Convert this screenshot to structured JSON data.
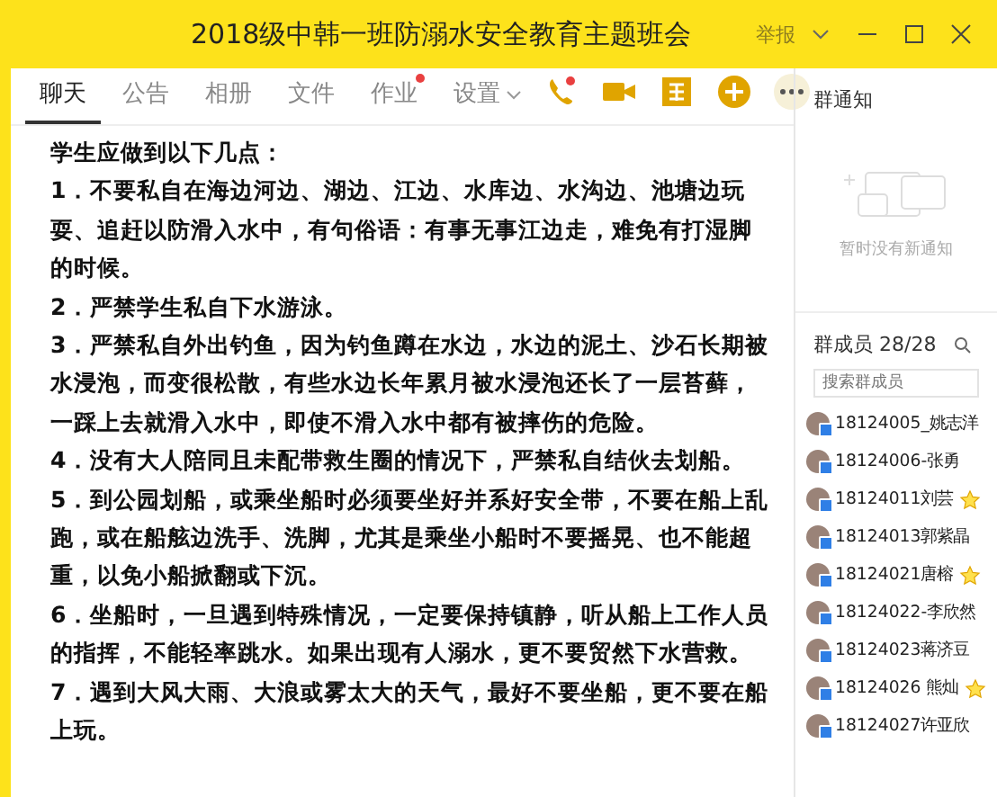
{
  "window": {
    "title": "2018级中韩一班防溺水安全教育主题班会",
    "report": "举报"
  },
  "tabs": [
    {
      "label": "聊天",
      "selected": true,
      "dot": false
    },
    {
      "label": "公告",
      "selected": false,
      "dot": false
    },
    {
      "label": "相册",
      "selected": false,
      "dot": false
    },
    {
      "label": "文件",
      "selected": false,
      "dot": false
    },
    {
      "label": "作业",
      "selected": false,
      "dot": true
    },
    {
      "label": "设置",
      "selected": false,
      "dot": false,
      "menu": true
    }
  ],
  "message": {
    "paragraphs": [
      "学生应做到以下几点：",
      "1．不要私自在海边河边、湖边、江边、水库边、水沟边、池塘边玩耍、追赶以防滑入水中，有句俗语：有事无事江边走，难免有打湿脚的时候。",
      "2．严禁学生私自下水游泳。",
      "3．严禁私自外出钓鱼，因为钓鱼蹲在水边，水边的泥土、沙石长期被水浸泡，而变很松散，有些水边长年累月被水浸泡还长了一层苔藓，一踩上去就滑入水中，即使不滑入水中都有被摔伤的危险。",
      "4．没有大人陪同且未配带救生圈的情况下，严禁私自结伙去划船。",
      "5．到公园划船，或乘坐船时必须要坐好并系好安全带，不要在船上乱跑，或在船舷边洗手、洗脚，尤其是乘坐小船时不要摇晃、也不能超重，以免小船掀翻或下沉。",
      "6．坐船时，一旦遇到特殊情况，一定要保持镇静，听从船上工作人员的指挥，不能轻率跳水。如果出现有人溺水，更不要贸然下水营救。",
      "7．遇到大风大雨、大浪或雾太大的天气，最好不要坐船，更不要在船上玩。"
    ]
  },
  "notice": {
    "title": "群通知",
    "empty": "暂时没有新通知"
  },
  "members": {
    "title": "群成员",
    "count": "28/28",
    "search": {
      "placeholder": "搜索群成员"
    },
    "list": [
      {
        "name": "18124005_姚志洋",
        "admin": false
      },
      {
        "name": "18124006-张勇",
        "admin": false
      },
      {
        "name": "18124011刘芸",
        "admin": true
      },
      {
        "name": "18124013郭紫晶",
        "admin": false
      },
      {
        "name": "18124021唐榕",
        "admin": true
      },
      {
        "name": "18124022-李欣然",
        "admin": false
      },
      {
        "name": "18124023蒋济豆",
        "admin": false
      },
      {
        "name": "18124026 熊灿",
        "admin": true
      },
      {
        "name": "18124027许亚欣",
        "admin": false
      }
    ]
  }
}
